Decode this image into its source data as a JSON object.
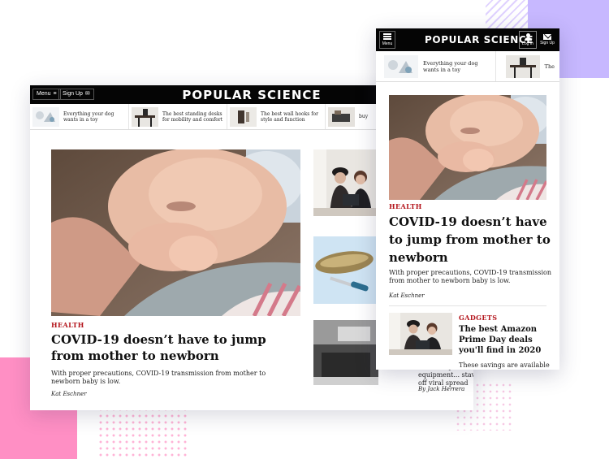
{
  "desktop": {
    "header": {
      "menu_label": "Menu",
      "signup_label": "Sign Up",
      "logo": "POPULAR SCIENCE"
    },
    "ticker": [
      {
        "text": "Everything your dog wants in a toy"
      },
      {
        "text": "The best standing desks for mobility and comfort"
      },
      {
        "text": "The best wall hooks for style and function"
      },
      {
        "text": "buy"
      }
    ],
    "lead": {
      "category": "HEALTH",
      "headline": "COVID-19 doesn’t have to jump from mother to newborn",
      "dek": "With proper precautions, COVID-19 transmission from mother to newborn baby is low.",
      "byline": "Kat Eschner"
    },
    "side": {
      "snippet": "with fancy lab equipment... stave off viral spread",
      "byline": "By Jack Herrera"
    }
  },
  "mobile": {
    "header": {
      "menu_label": "Menu",
      "logo": "POPULAR SCIENCE",
      "login_label": "Log In",
      "signup_label": "Sign Up"
    },
    "ticker": [
      {
        "text": "Everything your dog wants in a toy"
      },
      {
        "text": "The"
      }
    ],
    "lead": {
      "category": "HEALTH",
      "headline": "COVID-19 doesn’t have to jump from mother to newborn",
      "dek": "With proper precautions, COVID-19 transmission from mother to newborn baby is low.",
      "byline": "Kat Eschner"
    },
    "card": {
      "category": "GADGETS",
      "title": "The best Amazon Prime Day deals you'll find in 2020",
      "dek": "These savings are available"
    }
  },
  "colors": {
    "header_bg": "#050505",
    "category_red": "#b3141b",
    "lilac": "#c7b8ff",
    "pink": "#ff8fc4"
  }
}
